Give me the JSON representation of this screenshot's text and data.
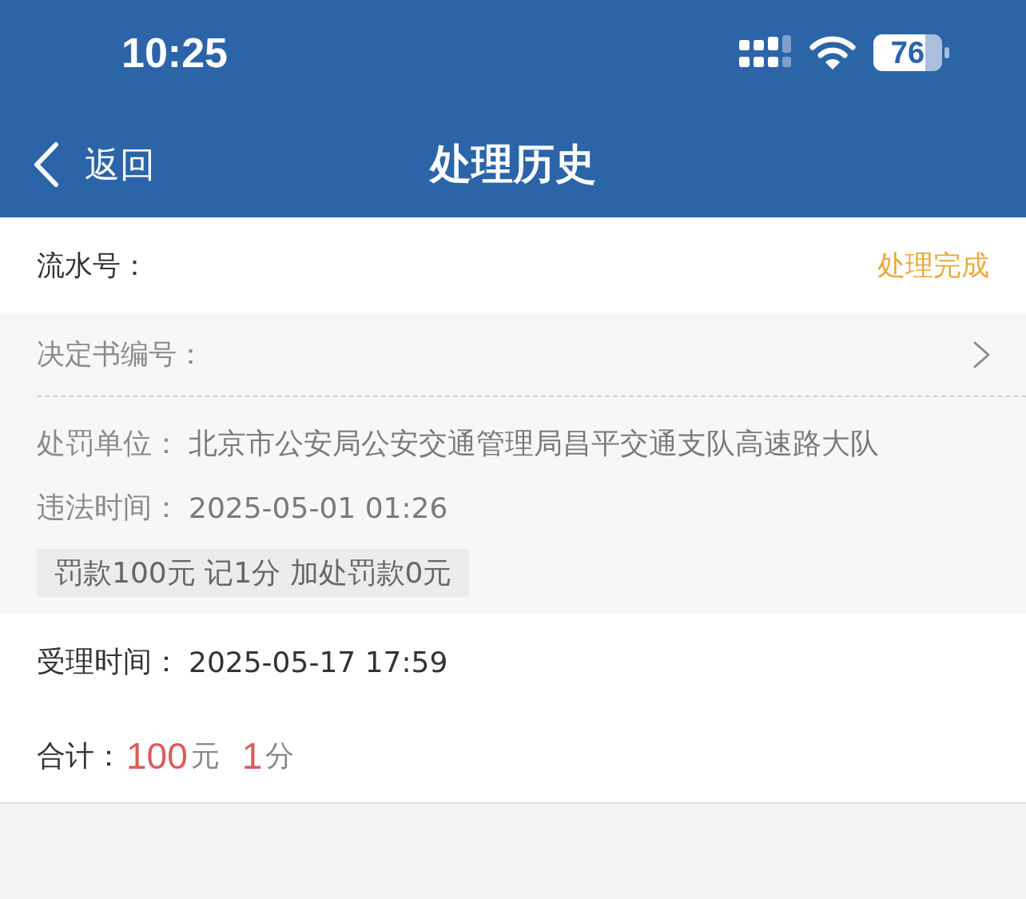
{
  "status_bar": {
    "time": "10:25",
    "battery": "76"
  },
  "nav_bar": {
    "back": "返回",
    "title": "处理历史"
  },
  "record": {
    "serial_label": "流水号：",
    "status": "处理完成",
    "decision_label": "决定书编号：",
    "details": [
      {
        "label": "处罚单位：",
        "value": "北京市公安局公安交通管理局昌平交通支队高速路大队"
      },
      {
        "label": "违法时间：",
        "value": "2025-05-01 01:26"
      }
    ],
    "penalty_tag": "罚款100元 记1分 加处罚款0元",
    "accepted": {
      "label": "受理时间：",
      "value": "2025-05-17 17:59"
    },
    "total": {
      "label": "合计：",
      "amount": "100",
      "amount_unit": "元",
      "points": "1",
      "points_unit": "分"
    }
  }
}
